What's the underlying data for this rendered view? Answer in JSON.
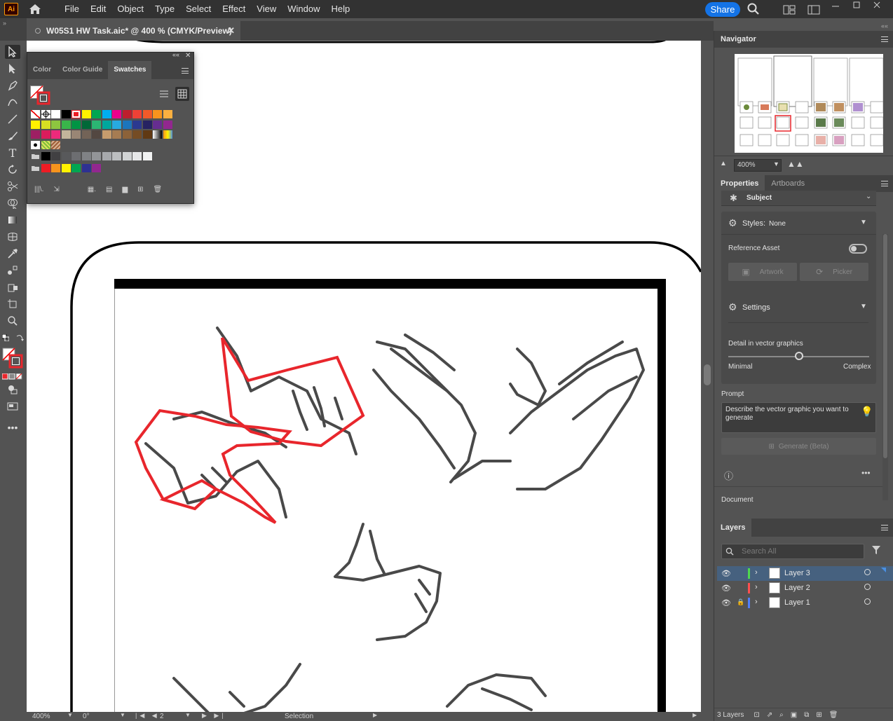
{
  "app": {
    "logo_text": "Ai",
    "menu": [
      "File",
      "Edit",
      "Object",
      "Type",
      "Select",
      "Effect",
      "View",
      "Window",
      "Help"
    ],
    "share_label": "Share"
  },
  "document": {
    "tab_title": "W05S1 HW Task.aic* @ 400 % (CMYK/Preview)"
  },
  "swatches_panel": {
    "tabs": [
      "Color",
      "Color Guide",
      "Swatches"
    ],
    "active_tab": "Swatches",
    "rows": [
      [
        "none",
        "reg",
        "#ffffff",
        "#000000",
        "#ed1c24-sel",
        "#fff200",
        "#00a651",
        "#00aeef",
        "#ec008c",
        "#be1e2d",
        "#ef4136",
        "#f15a29",
        "#f7941d",
        "#fbb040"
      ],
      [
        "#fff200",
        "#d7df23",
        "#8dc63f",
        "#39b54a",
        "#009444",
        "#006838",
        "#2bb673",
        "#00a79d",
        "#27aae1",
        "#1c75bc",
        "#2b3990",
        "#262262",
        "#662d91",
        "#92278f"
      ],
      [
        "#9e1f63",
        "#da1c5c",
        "#ee2a7b",
        "#c2b59b",
        "#998675",
        "#736357",
        "#534741",
        "#c69c6d",
        "#a67c52",
        "#8c6239",
        "#754c24",
        "#603913",
        "grad1",
        "grad2"
      ],
      [
        "pat1",
        "pat2",
        "pat3"
      ],
      [
        "folder",
        "#000000",
        "#414042",
        "#58595b",
        "#6d6e71",
        "#808285",
        "#939598",
        "#a7a9ac",
        "#bcbec0",
        "#d1d3d4",
        "#e6e7e8",
        "#f1f2f2"
      ],
      [
        "folder",
        "#ed1c24",
        "#f7941d",
        "#fff200",
        "#00a651",
        "#2e3192",
        "#92278f"
      ]
    ]
  },
  "navigator": {
    "title": "Navigator",
    "zoom": "400%"
  },
  "properties": {
    "tabs": [
      "Properties",
      "Artboards"
    ],
    "subject_label": "Subject",
    "styles_label": "Styles:",
    "styles_value": "None",
    "reference_asset_label": "Reference Asset",
    "artwork_label": "Artwork",
    "picker_label": "Picker",
    "settings_label": "Settings",
    "detail_label": "Detail in vector graphics",
    "minimal_label": "Minimal",
    "complex_label": "Complex",
    "detail_level": 0.5,
    "prompt_label": "Prompt",
    "prompt_placeholder": "Describe the vector graphic you want to generate",
    "generate_label": "Generate (Beta)",
    "document_label": "Document"
  },
  "layers": {
    "title": "Layers",
    "search_placeholder": "Search All",
    "items": [
      {
        "name": "Layer 3",
        "color": "#4fd84f",
        "locked": false,
        "selected": true
      },
      {
        "name": "Layer 2",
        "color": "#ff4f4f",
        "locked": false,
        "selected": false
      },
      {
        "name": "Layer 1",
        "color": "#4f7fff",
        "locked": true,
        "selected": false
      }
    ],
    "count_label": "3 Layers"
  },
  "status": {
    "zoom": "400%",
    "rotation": "0°",
    "artboard": "2",
    "tool": "Selection"
  }
}
